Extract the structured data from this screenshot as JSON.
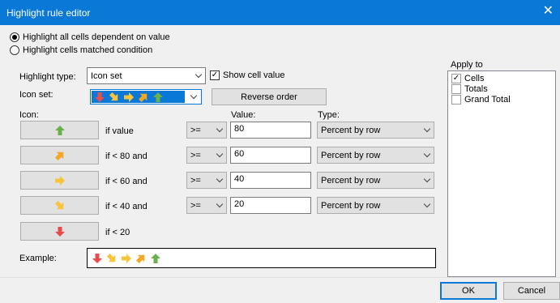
{
  "window": {
    "title": "Highlight rule editor",
    "close_glyph": "✕"
  },
  "mode": {
    "options": [
      {
        "label": "Highlight all cells dependent on value",
        "selected": true
      },
      {
        "label": "Highlight cells matched condition",
        "selected": false
      }
    ]
  },
  "highlight_type": {
    "label": "Highlight type:",
    "value": "Icon set"
  },
  "show_cell_value": {
    "label": "Show cell value",
    "checked": true,
    "check_glyph": "✓"
  },
  "icon_set": {
    "label": "Icon set:"
  },
  "reverse_order_label": "Reverse order",
  "columns": {
    "icon": "Icon:",
    "value": "Value:",
    "type": "Type:"
  },
  "rules": [
    {
      "icon": "arrow-up-green-icon",
      "condition": "if value",
      "operator": ">=",
      "value": "80",
      "type": "Percent by row"
    },
    {
      "icon": "arrow-up-right-orange-icon",
      "condition": "if < 80 and",
      "operator": ">=",
      "value": "60",
      "type": "Percent by row"
    },
    {
      "icon": "arrow-right-yellow-icon",
      "condition": "if < 60 and",
      "operator": ">=",
      "value": "40",
      "type": "Percent by row"
    },
    {
      "icon": "arrow-down-right-yellow-icon",
      "condition": "if < 40 and",
      "operator": ">=",
      "value": "20",
      "type": "Percent by row"
    },
    {
      "icon": "arrow-down-red-icon",
      "condition": "if < 20"
    }
  ],
  "example": {
    "label": "Example:"
  },
  "apply_to": {
    "label": "Apply to",
    "items": [
      {
        "label": "Cells",
        "checked": true
      },
      {
        "label": "Totals",
        "checked": false
      },
      {
        "label": "Grand Total",
        "checked": false
      }
    ]
  },
  "buttons": {
    "ok": "OK",
    "cancel": "Cancel"
  },
  "colors": {
    "accent": "#0a78d7",
    "arrow_green": "#6ab04c",
    "arrow_orange": "#f5a623",
    "arrow_yellow": "#f7c43b",
    "arrow_red": "#e84c4c"
  }
}
